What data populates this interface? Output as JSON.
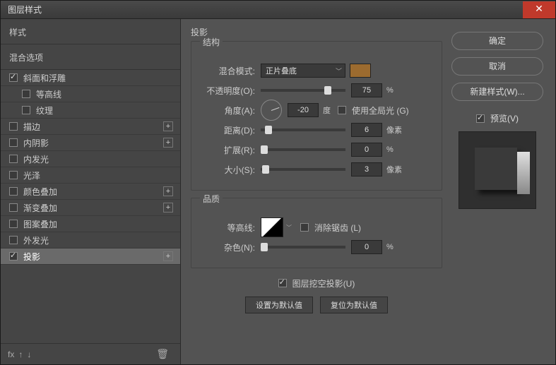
{
  "window": {
    "title": "图层样式"
  },
  "sidebar": {
    "header1": "样式",
    "header2": "混合选项",
    "items": [
      {
        "label": "斜面和浮雕",
        "checked": true,
        "indent": false,
        "plus": false
      },
      {
        "label": "等高线",
        "checked": false,
        "indent": true,
        "plus": false
      },
      {
        "label": "纹理",
        "checked": false,
        "indent": true,
        "plus": false
      },
      {
        "label": "描边",
        "checked": false,
        "indent": false,
        "plus": true
      },
      {
        "label": "内阴影",
        "checked": false,
        "indent": false,
        "plus": true
      },
      {
        "label": "内发光",
        "checked": false,
        "indent": false,
        "plus": false
      },
      {
        "label": "光泽",
        "checked": false,
        "indent": false,
        "plus": false
      },
      {
        "label": "颜色叠加",
        "checked": false,
        "indent": false,
        "plus": true
      },
      {
        "label": "渐变叠加",
        "checked": false,
        "indent": false,
        "plus": true
      },
      {
        "label": "图案叠加",
        "checked": false,
        "indent": false,
        "plus": false
      },
      {
        "label": "外发光",
        "checked": false,
        "indent": false,
        "plus": false
      },
      {
        "label": "投影",
        "checked": true,
        "indent": false,
        "plus": true,
        "selected": true
      }
    ],
    "footer": {
      "fx": "fx"
    }
  },
  "main": {
    "title": "投影",
    "structure": {
      "legend": "结构",
      "blend_label": "混合模式:",
      "blend_value": "正片叠底",
      "opacity_label": "不透明度(O):",
      "opacity_value": "75",
      "opacity_unit": "%",
      "angle_label": "角度(A):",
      "angle_value": "-20",
      "angle_unit": "度",
      "global_label": "使用全局光 (G)",
      "distance_label": "距离(D):",
      "distance_value": "6",
      "distance_unit": "像素",
      "spread_label": "扩展(R):",
      "spread_value": "0",
      "spread_unit": "%",
      "size_label": "大小(S):",
      "size_value": "3",
      "size_unit": "像素"
    },
    "quality": {
      "legend": "品质",
      "contour_label": "等高线:",
      "antialias_label": "消除锯齿 (L)",
      "noise_label": "杂色(N):",
      "noise_value": "0",
      "noise_unit": "%"
    },
    "knockout_label": "图层挖空投影(U)",
    "btn_default": "设置为默认值",
    "btn_reset": "复位为默认值"
  },
  "right": {
    "ok": "确定",
    "cancel": "取消",
    "new_style": "新建样式(W)...",
    "preview_label": "预览(V)"
  }
}
